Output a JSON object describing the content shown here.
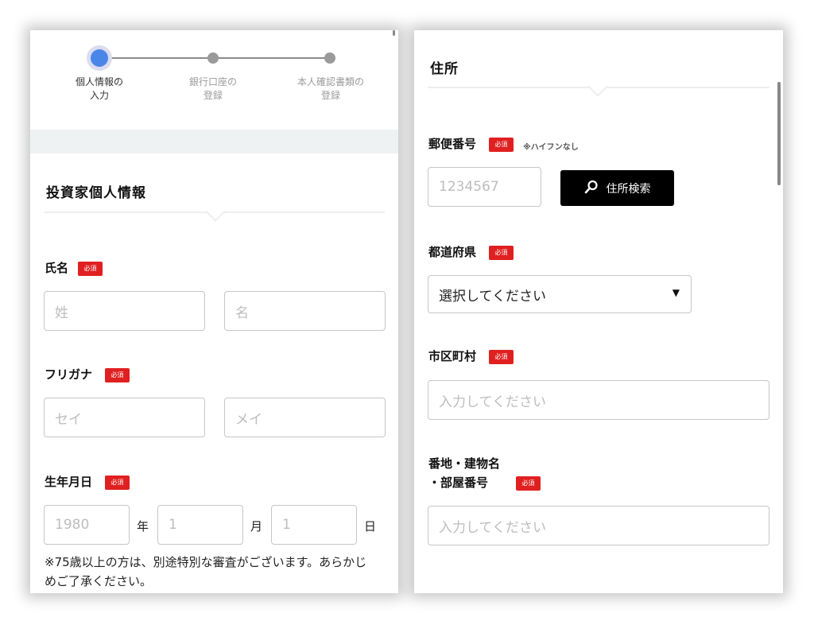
{
  "steps": [
    {
      "label": "個人情報の\n入力",
      "active": true
    },
    {
      "label": "銀行口座の\n登録",
      "active": false
    },
    {
      "label": "本人確認書類の\n登録",
      "active": false
    }
  ],
  "left": {
    "section_title": "投資家個人情報",
    "required_badge": "必須",
    "name": {
      "label": "氏名",
      "last_placeholder": "姓",
      "first_placeholder": "名"
    },
    "kana": {
      "label": "フリガナ",
      "last_placeholder": "セイ",
      "first_placeholder": "メイ"
    },
    "birth": {
      "label": "生年月日",
      "year_value": "1980",
      "year_unit": "年",
      "month_value": "1",
      "month_unit": "月",
      "day_value": "1",
      "day_unit": "日"
    },
    "note": "※75歳以上の方は、別途特別な審査がございます。あらかじめご了承ください。"
  },
  "right": {
    "section_title": "住所",
    "required_badge": "必須",
    "postal": {
      "label": "郵便番号",
      "hint": "※ハイフンなし",
      "placeholder": "1234567",
      "search_label": "住所検索"
    },
    "prefecture": {
      "label": "都道府県",
      "value": "選択してください"
    },
    "city": {
      "label": "市区町村",
      "placeholder": "入力してください"
    },
    "address": {
      "label_line1": "番地・建物名",
      "label_line2": "・部屋番号",
      "placeholder": "入力してください"
    }
  },
  "icons": {
    "search": "search-icon",
    "dropdown": "caret-down-icon"
  }
}
